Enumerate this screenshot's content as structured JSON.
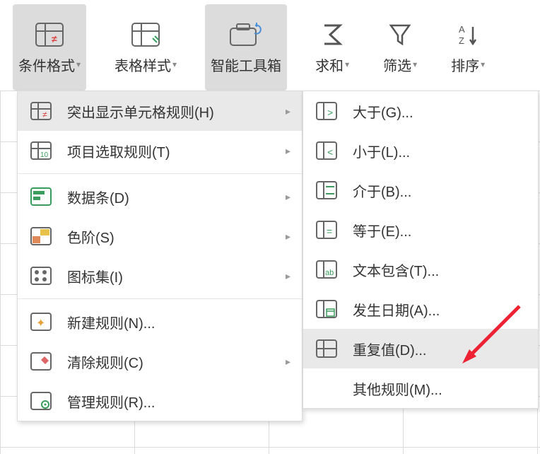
{
  "ribbon": {
    "cond_fmt": "条件格式",
    "tbl_style": "表格样式",
    "toolbox": "智能工具箱",
    "sum": "求和",
    "filter": "筛选",
    "sort": "排序"
  },
  "menu1": {
    "highlight": "突出显示单元格规则(H)",
    "top_rules": "项目选取规则(T)",
    "data_bars": "数据条(D)",
    "color_sc": "色阶(S)",
    "icon_sets": "图标集(I)",
    "new_rule": "新建规则(N)...",
    "clear": "清除规则(C)",
    "manage": "管理规则(R)..."
  },
  "menu2": {
    "gt": "大于(G)...",
    "lt": "小于(L)...",
    "between": "介于(B)...",
    "equal": "等于(E)...",
    "text": "文本包含(T)...",
    "date": "发生日期(A)...",
    "dup": "重复值(D)...",
    "more": "其他规则(M)..."
  }
}
